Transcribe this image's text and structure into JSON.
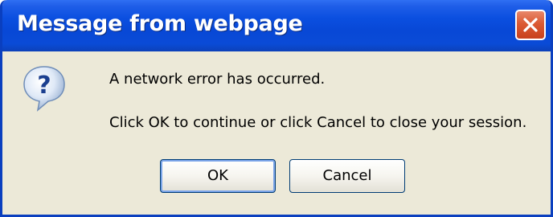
{
  "window": {
    "title": "Message from webpage"
  },
  "message": {
    "line1": "A network error has occurred.",
    "line2": "Click OK to continue or click Cancel to close your session."
  },
  "buttons": {
    "ok_label": "OK",
    "cancel_label": "Cancel"
  },
  "icons": {
    "dialog_icon": "question-icon",
    "close_icon": "close-icon"
  },
  "colors": {
    "titlebar": "#0a4bd7",
    "close_button": "#db5a33",
    "dialog_background": "#ece9d8"
  }
}
